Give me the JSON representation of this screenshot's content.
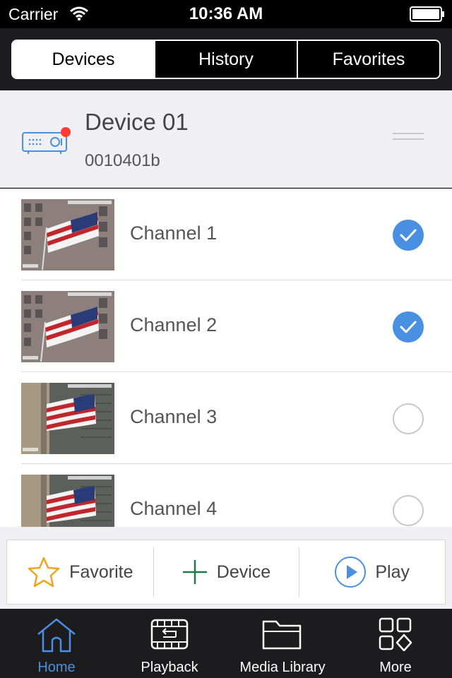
{
  "status": {
    "carrier": "Carrier",
    "time": "10:36 AM"
  },
  "segments": [
    {
      "label": "Devices",
      "active": true
    },
    {
      "label": "History",
      "active": false
    },
    {
      "label": "Favorites",
      "active": false
    }
  ],
  "device": {
    "name": "Device 01",
    "id": "0010401b",
    "online_color": "#ff3b30"
  },
  "channels": [
    {
      "label": "Channel 1",
      "selected": true
    },
    {
      "label": "Channel 2",
      "selected": true
    },
    {
      "label": "Channel 3",
      "selected": false
    },
    {
      "label": "Channel 4",
      "selected": false
    }
  ],
  "actions": {
    "favorite": "Favorite",
    "device": "Device",
    "play": "Play"
  },
  "tabs": [
    {
      "label": "Home",
      "icon": "home-icon",
      "active": true
    },
    {
      "label": "Playback",
      "icon": "playback-icon",
      "active": false
    },
    {
      "label": "Media Library",
      "icon": "folder-icon",
      "active": false
    },
    {
      "label": "More",
      "icon": "more-icon",
      "active": false
    }
  ],
  "colors": {
    "accent": "#4a90e2",
    "star": "#f0a51c",
    "plus": "#1e7a4a"
  }
}
